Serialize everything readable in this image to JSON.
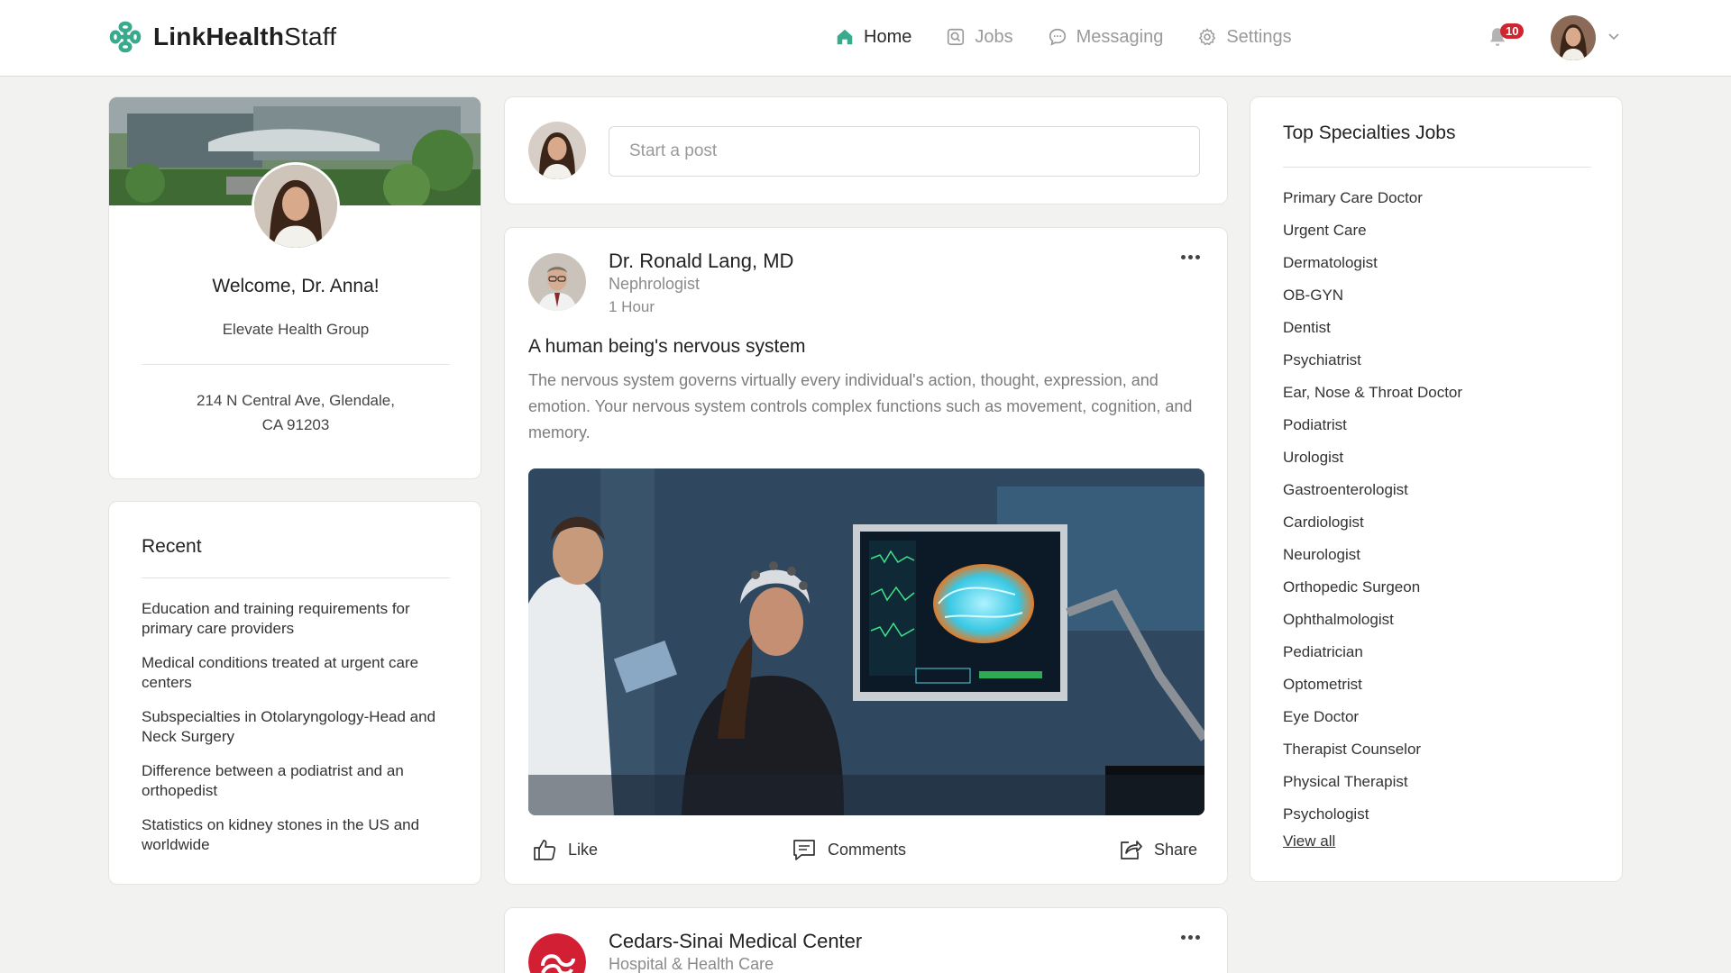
{
  "brand": {
    "name_bold": "LinkHealth",
    "name_light": "Staff",
    "accent": "#3aaa8f"
  },
  "nav": {
    "items": [
      {
        "label": "Home",
        "icon": "home-icon",
        "active": true
      },
      {
        "label": "Jobs",
        "icon": "jobs-icon",
        "active": false
      },
      {
        "label": "Messaging",
        "icon": "messaging-icon",
        "active": false
      },
      {
        "label": "Settings",
        "icon": "settings-icon",
        "active": false
      }
    ],
    "notifications_count": "10"
  },
  "profile": {
    "welcome": "Welcome, Dr. Anna!",
    "organization": "Elevate Health Group",
    "address_line1": "214 N Central Ave, Glendale,",
    "address_line2": "CA 91203"
  },
  "recent": {
    "title": "Recent",
    "items": [
      "Education and training requirements for primary care providers",
      "Medical conditions treated at urgent care centers",
      "Subspecialties in Otolaryngology-Head and Neck Surgery",
      "Difference between a podiatrist and an orthopedist",
      "Statistics on kidney stones in the US and worldwide"
    ]
  },
  "composer": {
    "placeholder": "Start a post"
  },
  "post": {
    "author": "Dr. Ronald Lang, MD",
    "role": "Nephrologist",
    "time": "1 Hour",
    "title": "A human being's nervous system",
    "body": "The nervous system governs virtually every individual's action, thought, expression, and emotion. Your nervous system controls complex functions such as movement, cognition, and memory.",
    "actions": {
      "like": "Like",
      "comments": "Comments",
      "share": "Share"
    }
  },
  "post2": {
    "author": "Cedars-Sinai Medical Center",
    "role": "Hospital & Health Care"
  },
  "specialties": {
    "title": "Top Specialties Jobs",
    "items": [
      "Primary Care Doctor",
      "Urgent Care",
      "Dermatologist",
      "OB-GYN",
      "Dentist",
      "Psychiatrist",
      "Ear, Nose & Throat Doctor",
      "Podiatrist",
      "Urologist",
      "Gastroenterologist",
      "Cardiologist",
      "Neurologist",
      "Orthopedic Surgeon",
      "Ophthalmologist",
      "Pediatrician",
      "Optometrist",
      "Eye Doctor",
      "Therapist Counselor",
      "Physical Therapist",
      "Psychologist"
    ],
    "view_all": "View all"
  }
}
